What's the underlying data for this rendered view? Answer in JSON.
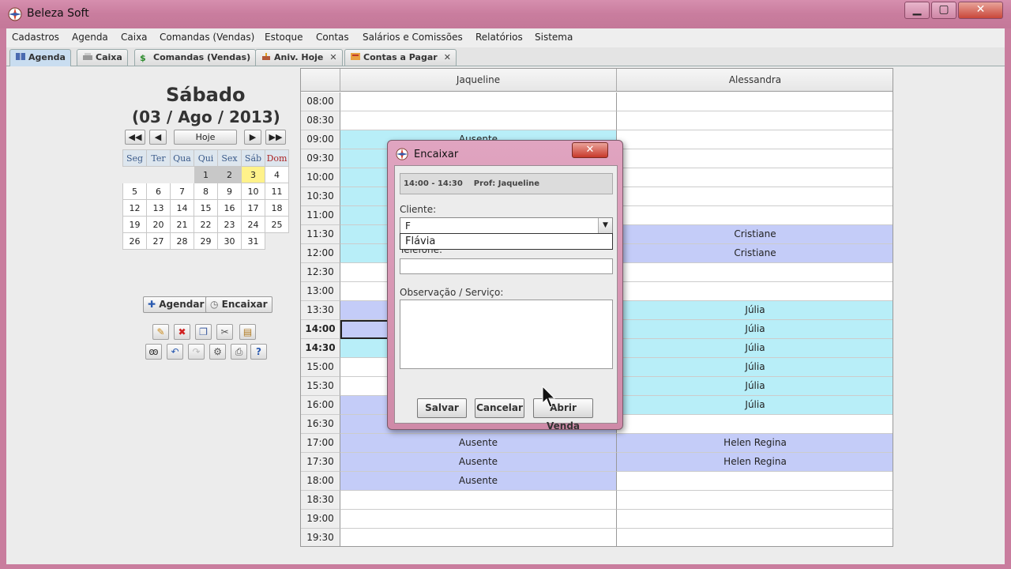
{
  "window": {
    "title": "Beleza Soft",
    "min": "▁",
    "max": "▢",
    "close": "✕"
  },
  "menu": [
    "Cadastros",
    "Agenda",
    "Caixa",
    "Comandas (Vendas)",
    "Estoque",
    "Contas",
    "Salários e Comissões",
    "Relatórios",
    "Sistema"
  ],
  "tabs": [
    {
      "label": "Agenda",
      "icon": "book-icon",
      "closable": false,
      "active": true
    },
    {
      "label": "Caixa",
      "icon": "cash-register-icon",
      "closable": false
    },
    {
      "label": "Comandas (Vendas)",
      "icon": "dollar-icon",
      "closable": false
    },
    {
      "label": "Aniv. Hoje",
      "icon": "cake-icon",
      "closable": true
    },
    {
      "label": "Contas a Pagar",
      "icon": "bill-icon",
      "closable": true
    }
  ],
  "tab_close": "✕",
  "day": {
    "name": "Sábado",
    "date": "(03 / Ago / 2013)"
  },
  "nav": {
    "first": "◀◀",
    "prev": "◀",
    "today": "Hoje",
    "next": "▶",
    "last": "▶▶"
  },
  "calendar": {
    "weekdays": [
      "Seg",
      "Ter",
      "Qua",
      "Qui",
      "Sex",
      "Sáb",
      "Dom"
    ],
    "weeks": [
      [
        "",
        "",
        "",
        "1",
        "2",
        "3",
        "4"
      ],
      [
        "5",
        "6",
        "7",
        "8",
        "9",
        "10",
        "11"
      ],
      [
        "12",
        "13",
        "14",
        "15",
        "16",
        "17",
        "18"
      ],
      [
        "19",
        "20",
        "21",
        "22",
        "23",
        "24",
        "25"
      ],
      [
        "26",
        "27",
        "28",
        "29",
        "30",
        "31",
        ""
      ]
    ],
    "past": [
      "1",
      "2"
    ],
    "today": "3"
  },
  "actions": {
    "agendar": "Agendar",
    "encaixar": "Encaixar"
  },
  "schedule": {
    "columns": [
      "Jaqueline",
      "Alessandra"
    ],
    "rows": [
      {
        "time": "08:00",
        "c1": "",
        "c1s": "",
        "c2": "",
        "c2s": ""
      },
      {
        "time": "08:30",
        "c1": "",
        "c1s": "",
        "c2": "",
        "c2s": ""
      },
      {
        "time": "09:00",
        "c1": "Ausente",
        "c1s": "cyan",
        "c2": "",
        "c2s": ""
      },
      {
        "time": "09:30",
        "c1": "",
        "c1s": "cyan",
        "c2": "",
        "c2s": ""
      },
      {
        "time": "10:00",
        "c1": "",
        "c1s": "cyan",
        "c2": "",
        "c2s": ""
      },
      {
        "time": "10:30",
        "c1": "",
        "c1s": "cyan",
        "c2": "",
        "c2s": ""
      },
      {
        "time": "11:00",
        "c1": "",
        "c1s": "cyan",
        "c2": "",
        "c2s": ""
      },
      {
        "time": "11:30",
        "c1": "",
        "c1s": "cyan",
        "c2": "Cristiane",
        "c2s": "blue"
      },
      {
        "time": "12:00",
        "c1": "",
        "c1s": "cyan",
        "c2": "Cristiane",
        "c2s": "blue"
      },
      {
        "time": "12:30",
        "c1": "",
        "c1s": "",
        "c2": "",
        "c2s": ""
      },
      {
        "time": "13:00",
        "c1": "",
        "c1s": "",
        "c2": "",
        "c2s": ""
      },
      {
        "time": "13:30",
        "c1": "",
        "c1s": "blue",
        "c2": "Júlia",
        "c2s": "cyan"
      },
      {
        "time": "14:00",
        "c1": "",
        "c1s": "blue",
        "c2": "Júlia",
        "c2s": "cyan",
        "bold": true
      },
      {
        "time": "14:30",
        "c1": "",
        "c1s": "cyan",
        "c2": "Júlia",
        "c2s": "cyan",
        "bold": true
      },
      {
        "time": "15:00",
        "c1": "",
        "c1s": "",
        "c2": "Júlia",
        "c2s": "cyan"
      },
      {
        "time": "15:30",
        "c1": "",
        "c1s": "",
        "c2": "Júlia",
        "c2s": "cyan"
      },
      {
        "time": "16:00",
        "c1": "",
        "c1s": "blue",
        "c2": "Júlia",
        "c2s": "cyan"
      },
      {
        "time": "16:30",
        "c1": "",
        "c1s": "blue",
        "c2": "",
        "c2s": ""
      },
      {
        "time": "17:00",
        "c1": "Ausente",
        "c1s": "blue",
        "c2": "Helen Regina",
        "c2s": "blue"
      },
      {
        "time": "17:30",
        "c1": "Ausente",
        "c1s": "blue",
        "c2": "Helen Regina",
        "c2s": "blue"
      },
      {
        "time": "18:00",
        "c1": "Ausente",
        "c1s": "blue",
        "c2": "",
        "c2s": ""
      },
      {
        "time": "18:30",
        "c1": "",
        "c1s": "",
        "c2": "",
        "c2s": ""
      },
      {
        "time": "19:00",
        "c1": "",
        "c1s": "",
        "c2": "",
        "c2s": ""
      },
      {
        "time": "19:30",
        "c1": "",
        "c1s": "",
        "c2": "",
        "c2s": ""
      }
    ]
  },
  "dialog": {
    "title": "Encaixar",
    "close": "✕",
    "time_range": "14:00 - 14:30",
    "prof": "Prof: Jaqueline",
    "cliente_label": "Cliente:",
    "cliente_value": "F",
    "suggestion": "Flávia",
    "telefone_label": "Telefone:",
    "obs_label": "Observação / Serviço:",
    "salvar": "Salvar",
    "cancelar": "Cancelar",
    "abrir_venda": "Abrir Venda"
  },
  "colors": {
    "cyan": "#b8eef8",
    "blue": "#c4ccf8",
    "title_bar": "#c97d9e",
    "today": "#fff28a"
  }
}
